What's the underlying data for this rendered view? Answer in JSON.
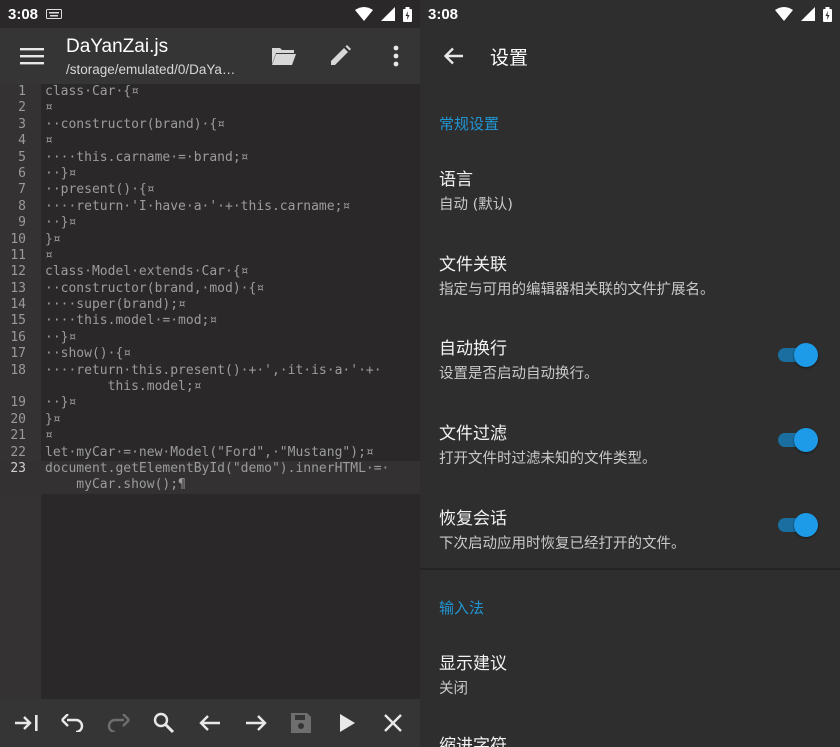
{
  "editor": {
    "status_time": "3:08",
    "file_name": "DaYanZai.js",
    "file_path": "/storage/emulated/0/DaYa…",
    "code_lines": [
      {
        "num": "1",
        "text": "class·Car·{¤"
      },
      {
        "num": "2",
        "text": "¤"
      },
      {
        "num": "3",
        "text": "··constructor(brand)·{¤"
      },
      {
        "num": "4",
        "text": "¤"
      },
      {
        "num": "5",
        "text": "····this.carname·=·brand;¤"
      },
      {
        "num": "6",
        "text": "··}¤"
      },
      {
        "num": "7",
        "text": "··present()·{¤"
      },
      {
        "num": "8",
        "text": "····return·'I·have·a·'·+·this.carname;¤"
      },
      {
        "num": "9",
        "text": "··}¤"
      },
      {
        "num": "10",
        "text": "}¤"
      },
      {
        "num": "11",
        "text": "¤"
      },
      {
        "num": "12",
        "text": "class·Model·extends·Car·{¤"
      },
      {
        "num": "13",
        "text": "··constructor(brand,·mod)·{¤"
      },
      {
        "num": "14",
        "text": "····super(brand);¤"
      },
      {
        "num": "15",
        "text": "····this.model·=·mod;¤"
      },
      {
        "num": "16",
        "text": "··}¤"
      },
      {
        "num": "17",
        "text": "··show()·{¤"
      },
      {
        "num": "18",
        "text": "····return·this.present()·+·',·it·is·a·'·+·"
      },
      {
        "num": "",
        "text": "        this.model;¤"
      },
      {
        "num": "19",
        "text": "··}¤"
      },
      {
        "num": "20",
        "text": "}¤"
      },
      {
        "num": "21",
        "text": "¤"
      },
      {
        "num": "22",
        "text": "let·myCar·=·new·Model(\"Ford\",·\"Mustang\");¤"
      },
      {
        "num": "23",
        "text": "document.getElementById(\"demo\").innerHTML·=·",
        "current": true
      },
      {
        "num": "",
        "text": "    myCar.show();¶",
        "current": true
      }
    ]
  },
  "settings": {
    "status_time": "3:08",
    "title": "设置",
    "sections": [
      {
        "label": "常规设置"
      },
      {
        "label": "输入法"
      }
    ],
    "items": [
      {
        "title": "语言",
        "subtitle": "自动 (默认)"
      },
      {
        "title": "文件关联",
        "subtitle": "指定与可用的编辑器相关联的文件扩展名。"
      },
      {
        "title": "自动换行",
        "subtitle": "设置是否启动自动换行。",
        "toggle": true
      },
      {
        "title": "文件过滤",
        "subtitle": "打开文件时过滤未知的文件类型。",
        "toggle": true
      },
      {
        "title": "恢复会话",
        "subtitle": "下次启动应用时恢复已经打开的文件。",
        "toggle": true
      },
      {
        "title": "显示建议",
        "subtitle": "关闭"
      },
      {
        "title": "缩进字符",
        "subtitle": ""
      }
    ]
  },
  "colors": {
    "accent": "#2196d3",
    "toggle_on": "#1e9be8"
  },
  "icons": {
    "menu": "menu-icon",
    "folder": "folder-open-icon",
    "edit": "pencil-icon",
    "more": "more-vert-icon",
    "back": "arrow-back-icon"
  }
}
